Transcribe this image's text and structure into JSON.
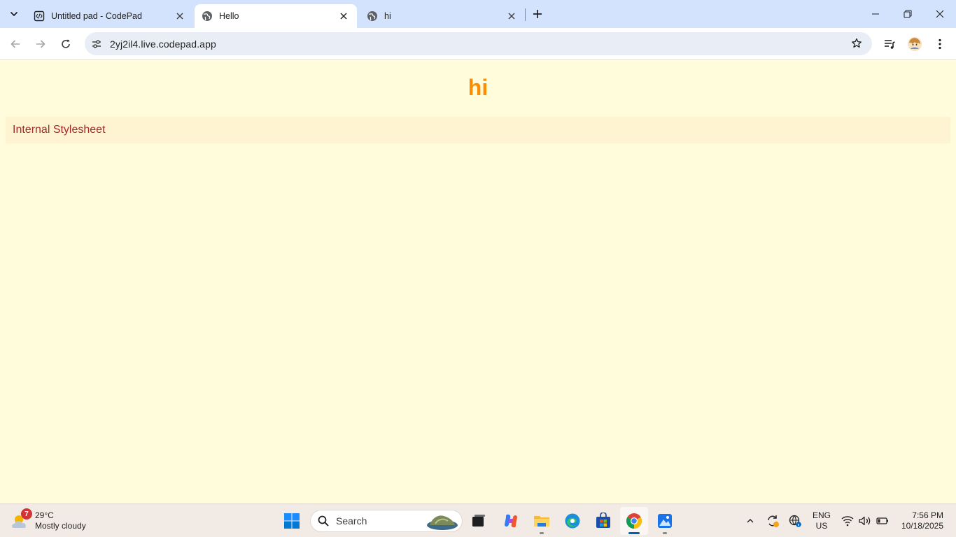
{
  "browser": {
    "tabs": [
      {
        "title": "Untitled pad - CodePad",
        "icon": "codepad-icon",
        "active": false
      },
      {
        "title": "Hello",
        "icon": "globe-icon",
        "active": true
      },
      {
        "title": "hi",
        "icon": "globe-icon",
        "active": false
      }
    ],
    "url": "2yj2il4.live.codepad.app"
  },
  "page": {
    "heading": "hi",
    "paragraph": "Internal Stylesheet",
    "colors": {
      "background": "#fffcdc",
      "heading": "#ff8c00",
      "paragraph_text": "#a52a2a",
      "paragraph_background": "#fff4d2"
    }
  },
  "taskbar": {
    "weather": {
      "badge": "7",
      "temperature": "29°C",
      "condition": "Mostly cloudy"
    },
    "search_label": "Search",
    "language": {
      "line1": "ENG",
      "line2": "US"
    },
    "clock": {
      "time": "7:56 PM",
      "date": "10/18/2025"
    }
  }
}
